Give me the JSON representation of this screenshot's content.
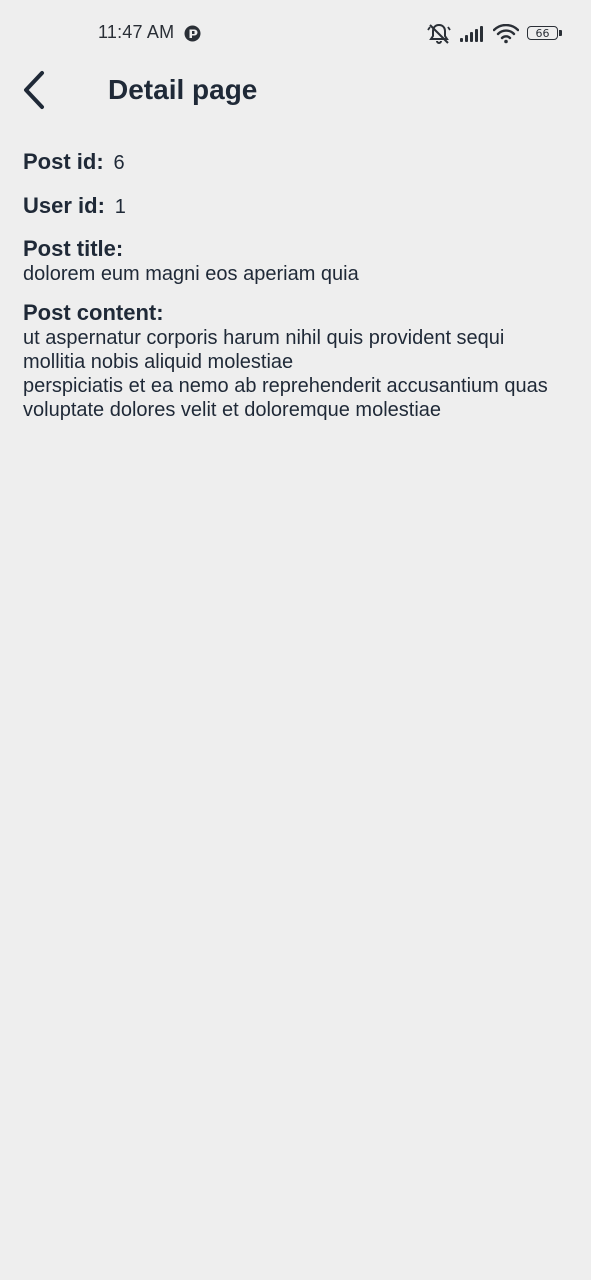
{
  "status_bar": {
    "time": "11:47 AM",
    "battery_level": "66",
    "icons": [
      "app-notification-icon",
      "mute-bell-icon",
      "signal-icon",
      "wifi-icon",
      "battery-icon"
    ]
  },
  "app_bar": {
    "title": "Detail page",
    "back_icon": "chevron-left-icon"
  },
  "post": {
    "post_id_label": "Post id:",
    "post_id": "6",
    "user_id_label": "User id:",
    "user_id": "1",
    "title_label": "Post title:",
    "title": "dolorem eum magni eos aperiam quia",
    "content_label": "Post content:",
    "content": "ut aspernatur corporis harum nihil quis provident sequi\nmollitia nobis aliquid molestiae\nperspiciatis et ea nemo ab reprehenderit accusantium quas\nvoluptate dolores velit et doloremque molestiae"
  },
  "colors": {
    "background": "#eeeeee",
    "text": "#1f2937"
  }
}
